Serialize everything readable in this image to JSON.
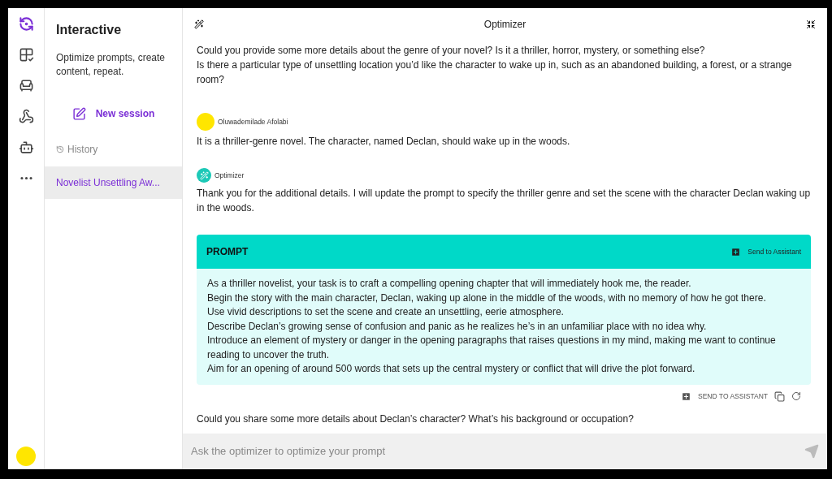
{
  "rail": {
    "items": [
      {
        "selected": true
      },
      {
        "selected": false
      },
      {
        "selected": false
      },
      {
        "selected": false
      },
      {
        "selected": false
      },
      {
        "selected": false
      }
    ]
  },
  "sidebar": {
    "title": "Interactive",
    "subtitle": "Optimize prompts, create content, repeat.",
    "new_session": "New session",
    "history_label": "History",
    "history": [
      {
        "label": "Novelist Unsettling Aw...",
        "selected": true
      }
    ]
  },
  "header": {
    "title": "Optimizer"
  },
  "messages": [
    {
      "kind": "text",
      "lines": [
        "Could you provide some more details about the genre of your novel? Is it a thriller, horror, mystery, or something else?",
        "Is there a particular type of unsettling location you’d like the character to wake up in, such as an abandoned building, a forest, or a strange room?"
      ]
    },
    {
      "kind": "user",
      "sender": "Oluwademilade Afolabi",
      "lines": [
        "It is a thriller-genre novel. The character, named Declan, should wake up in the woods."
      ]
    },
    {
      "kind": "bot",
      "sender": "Optimizer",
      "lines": [
        "Thank you for the additional details. I will update the prompt to specify the thriller genre and set the scene with the character Declan waking up in the woods."
      ]
    },
    {
      "kind": "prompt",
      "title": "PROMPT",
      "header_action": "Send to Assistant",
      "footer_action": "SEND TO ASSISTANT",
      "lines": [
        "As a thriller novelist, your task is to craft a compelling opening chapter that will immediately hook me, the reader.",
        "Begin the story with the main character, Declan, waking up alone in the middle of the woods, with no memory of how he got there.",
        "Use vivid descriptions to set the scene and create an unsettling, eerie atmosphere.",
        "Describe Declan’s growing sense of confusion and panic as he realizes he’s in an unfamiliar place with no idea why.",
        "Introduce an element of mystery or danger in the opening paragraphs that raises questions in my mind, making me want to continue reading to uncover the truth.",
        "Aim for an opening of around 500 words that sets up the central mystery or conflict that will drive the plot forward."
      ]
    },
    {
      "kind": "text",
      "lines": [
        "Could you share some more details about Declan’s character? What’s his background or occupation?"
      ]
    }
  ],
  "input": {
    "placeholder": "Ask the optimizer to optimize your prompt"
  }
}
